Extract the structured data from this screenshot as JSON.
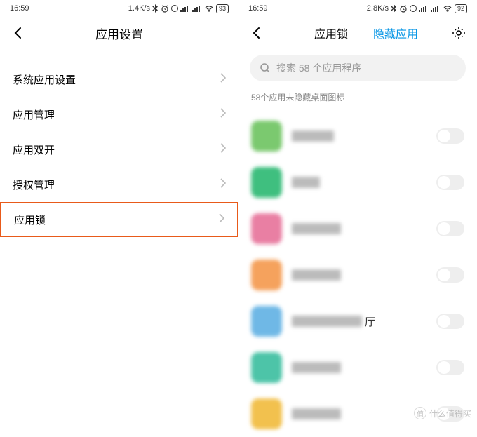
{
  "left": {
    "statusbar": {
      "time": "16:59",
      "net": "1.4K/s",
      "battery": "93"
    },
    "header": {
      "title": "应用设置"
    },
    "settings": [
      {
        "label": "系统应用设置",
        "highlight": false
      },
      {
        "label": "应用管理",
        "highlight": false
      },
      {
        "label": "应用双开",
        "highlight": false
      },
      {
        "label": "授权管理",
        "highlight": false
      },
      {
        "label": "应用锁",
        "highlight": true
      }
    ]
  },
  "right": {
    "statusbar": {
      "time": "16:59",
      "net": "2.8K/s",
      "battery": "92"
    },
    "header": {
      "tabs": [
        {
          "label": "应用锁",
          "active": false
        },
        {
          "label": "隐藏应用",
          "active": true
        }
      ]
    },
    "search": {
      "placeholder": "搜索 58 个应用程序"
    },
    "caption": "58个应用未隐藏桌面图标",
    "apps": [
      {
        "icon_color": "#7bc96f",
        "name_w": 60
      },
      {
        "icon_color": "#3fbf7f",
        "name_w": 40
      },
      {
        "icon_color": "#e97fa3",
        "name_w": 70
      },
      {
        "icon_color": "#f5a25d",
        "name_w": 70
      },
      {
        "icon_color": "#6fb8e6",
        "name_w": 100,
        "suffix": "厅"
      },
      {
        "icon_color": "#4dc4a8",
        "name_w": 70
      },
      {
        "icon_color": "#f2c14e",
        "name_w": 70
      }
    ]
  },
  "watermark": {
    "badge": "值",
    "text": "什么值得买"
  }
}
